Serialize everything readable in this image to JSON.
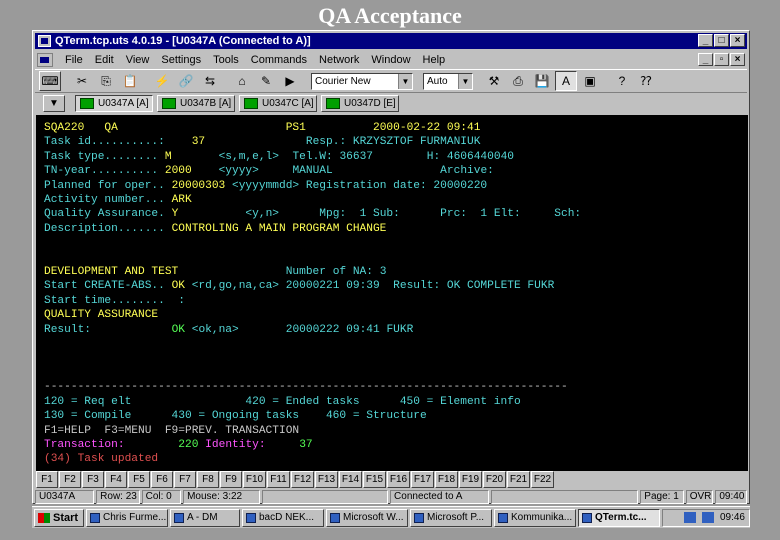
{
  "slide": {
    "title": "QA Acceptance"
  },
  "window": {
    "title": "QTerm.tcp.uts 4.0.19 - [U0347A (Connected to A)]",
    "menu": [
      "File",
      "Edit",
      "View",
      "Settings",
      "Tools",
      "Commands",
      "Network",
      "Window",
      "Help"
    ]
  },
  "toolbar": {
    "font_combo": "Courier New",
    "size_combo": "Auto"
  },
  "sessions": [
    {
      "label": "U0347A [A]",
      "active": true
    },
    {
      "label": "U0347B [A]",
      "active": false
    },
    {
      "label": "U0347C [A]",
      "active": false
    },
    {
      "label": "U0347D [E]",
      "active": false
    }
  ],
  "terminal": {
    "header_left": "SQA220   QA",
    "header_ps": "PS1",
    "header_date": "2000-02-22 09:41",
    "l1_label": "Task id..........:",
    "l1_val": "    37",
    "l1_resp": "Resp.: KRZYSZTOF FURMANIUK",
    "l2_label": "Task type........ ",
    "l2_val": "M",
    "l2_hint": "<s,m,e,l>",
    "l2_tel": "Tel.W: 36637        H: 4606440040",
    "l3_label": "TN-year.......... ",
    "l3_val": "2000",
    "l3_hint": "<yyyy>",
    "l3_manual": "MANUAL",
    "l3_archive": "Archive:",
    "l4_label": "Planned for oper.. ",
    "l4_val": "20000303",
    "l4_hint": "<yyyymmdd>",
    "l4_reg": "Registration date: 20000220",
    "l5_label": "Activity number... ",
    "l5_val": "ARK",
    "l6_label": "Quality Assurance. ",
    "l6_val": "Y",
    "l6_hint": "<y,n>",
    "l6_mpg": "Mpg:  1 Sub:      Prc:  1 Elt:     Sch:",
    "l7_label": "Description....... ",
    "l7_val": "CONTROLING A MAIN PROGRAM CHANGE",
    "dev_title": "DEVELOPMENT AND TEST",
    "dev_na": "Number of NA: 3",
    "start_label": "Start CREATE-ABS.. ",
    "start_val": "OK",
    "start_hint": "<rd,go,na,ca>",
    "start_date": "20000221 09:39",
    "start_result": "Result: OK COMPLETE FUKR",
    "start_time": "Start time........  :",
    "qa_title": "QUALITY ASSURANCE",
    "result_label": "Result:",
    "result_val": "OK",
    "result_hint": "<ok,na>",
    "result_date": "20000222 09:41 FUKR",
    "divider": "------------------------------------------------------------------------------",
    "menu1": "120 = Req elt                 420 = Ended tasks      450 = Element info",
    "menu2": "130 = Compile      430 = Ongoing tasks    460 = Structure",
    "keys": "F1=HELP  F3=MENU  F9=PREV. TRANSACTION",
    "trans_label": "Transaction:",
    "trans_val": "220",
    "ident_label": "Identity:",
    "ident_val": "37",
    "message": "(34) Task updated"
  },
  "fkeys": [
    "F1",
    "F2",
    "F3",
    "F4",
    "F5",
    "F6",
    "F7",
    "F8",
    "F9",
    "F10",
    "F11",
    "F12",
    "F13",
    "F14",
    "F15",
    "F16",
    "F17",
    "F18",
    "F19",
    "F20",
    "F21",
    "F22"
  ],
  "status": {
    "session": "U0347A",
    "row": "Row: 23",
    "col": "Col: 0",
    "mouse": "Mouse:  3:22",
    "conn": "Connected to A",
    "page": "Page: 1",
    "ovr": "OVR",
    "clock": "09:40"
  },
  "taskbar": {
    "start": "Start",
    "items": [
      "Chris Furme...",
      "A - DM",
      "bacD NEK...",
      "Microsoft W...",
      "Microsoft P...",
      "Kommunika...",
      "QTerm.tc..."
    ],
    "time": "09:46"
  }
}
